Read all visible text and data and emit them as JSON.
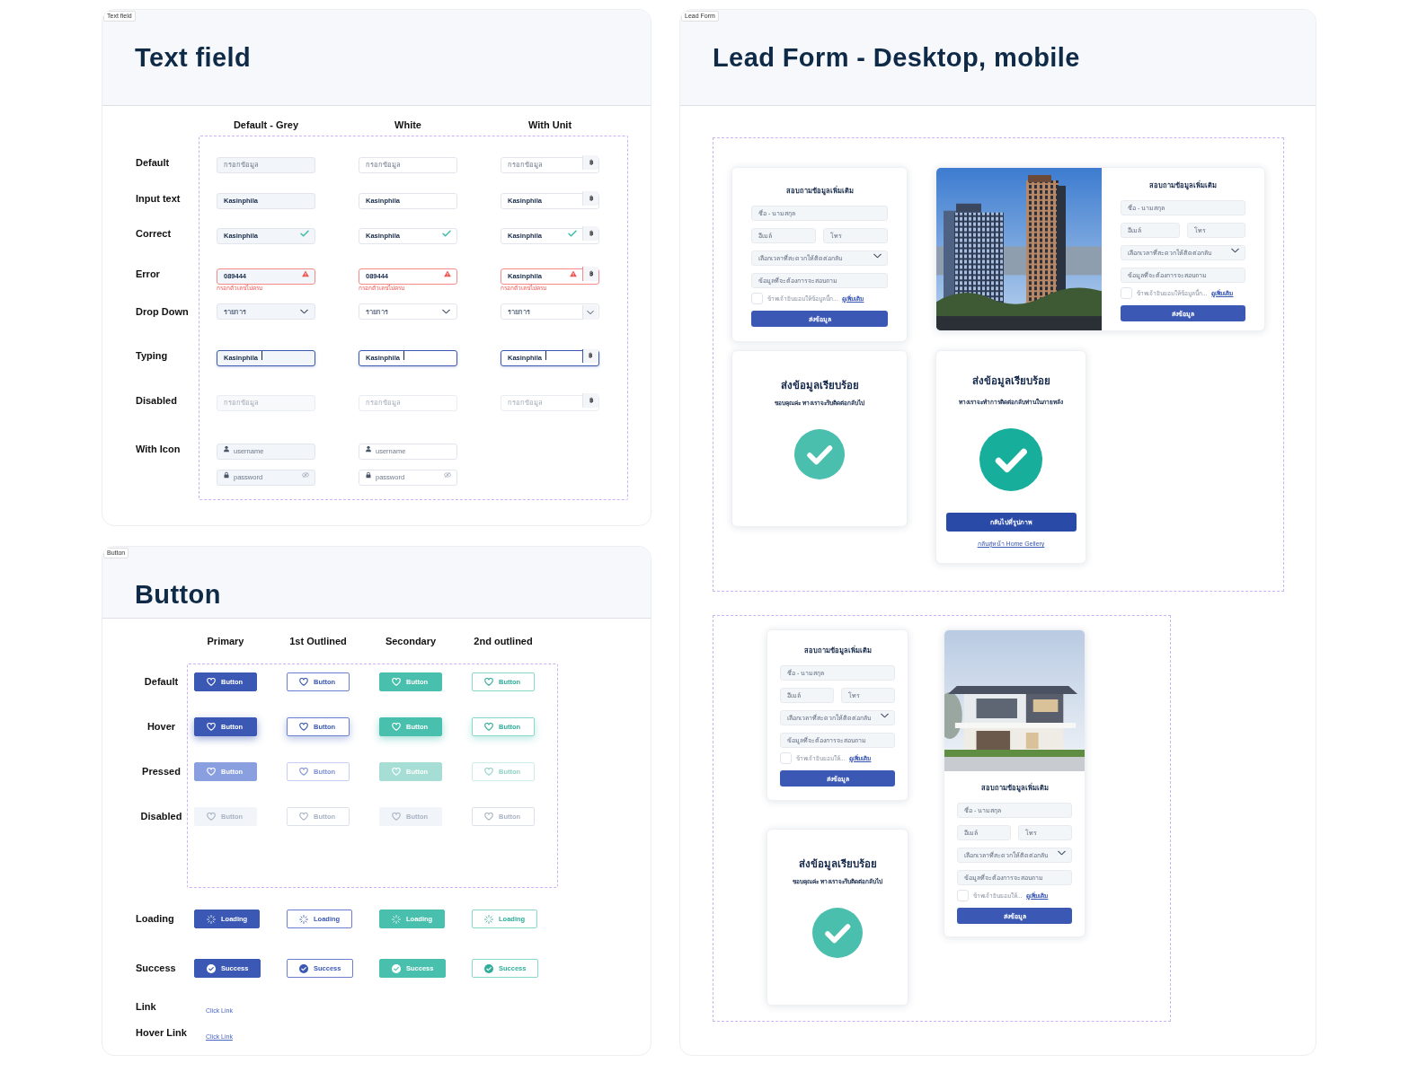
{
  "text_field": {
    "tag": "Text field",
    "title": "Text field",
    "columns": [
      {
        "label": "Default - Grey",
        "kind": "grey"
      },
      {
        "label": "White",
        "kind": "white"
      },
      {
        "label": "With Unit",
        "kind": "unit"
      }
    ],
    "rows": [
      {
        "label": "Default",
        "kind": "default",
        "cells": [
          {
            "placeholder": "กรอกข้อมูล"
          },
          {
            "placeholder": "กรอกข้อมูล"
          },
          {
            "placeholder": "กรอกข้อมูล",
            "unit": "฿"
          }
        ]
      },
      {
        "label": "Input text",
        "kind": "filled",
        "cells": [
          {
            "value": "Kasinphila"
          },
          {
            "value": "Kasinphila"
          },
          {
            "value": "Kasinphila",
            "unit": "฿"
          }
        ]
      },
      {
        "label": "Correct",
        "kind": "correct",
        "cells": [
          {
            "value": "Kasinphila"
          },
          {
            "value": "Kasinphila"
          },
          {
            "value": "Kasinphila",
            "unit": "฿"
          }
        ]
      },
      {
        "label": "Error",
        "kind": "error",
        "cells": [
          {
            "value": "089444",
            "error": "กรอกตัวเลขไม่ครบ"
          },
          {
            "value": "089444",
            "error": "กรอกตัวเลขไม่ครบ"
          },
          {
            "value": "Kasinphila",
            "error": "กรอกตัวเลขไม่ครบ",
            "unit": "฿"
          }
        ]
      },
      {
        "label": "Drop Down",
        "kind": "dropdown",
        "cells": [
          {
            "value": "รายการ"
          },
          {
            "value": "รายการ"
          },
          {
            "value": "รายการ"
          }
        ]
      },
      {
        "label": "Typing",
        "kind": "typing",
        "cells": [
          {
            "value": "Kasinphila"
          },
          {
            "value": "Kasinphila"
          },
          {
            "value": "Kasinphila",
            "unit": "฿"
          }
        ]
      },
      {
        "label": "Disabled",
        "kind": "disabled",
        "cells": [
          {
            "placeholder": "กรอกข้อมูล"
          },
          {
            "placeholder": "กรอกข้อมูล"
          },
          {
            "placeholder": "กรอกข้อมูล",
            "unit": "฿"
          }
        ]
      },
      {
        "label": "With Icon",
        "kind": "with_icon",
        "cells": [
          {
            "fields": [
              {
                "kind": "user",
                "placeholder": "username"
              },
              {
                "kind": "password",
                "placeholder": "password"
              }
            ]
          },
          {
            "fields": [
              {
                "kind": "user",
                "placeholder": "username"
              },
              {
                "kind": "password",
                "placeholder": "password"
              }
            ]
          }
        ]
      }
    ]
  },
  "buttons": {
    "tag": "Button",
    "title": "Button",
    "columns": [
      {
        "label": "Primary",
        "kind": "primary"
      },
      {
        "label": "1st Outlined",
        "kind": "outlined"
      },
      {
        "label": "Secondary",
        "kind": "secondary"
      },
      {
        "label": "2nd outlined",
        "kind": "outlined_secondary"
      }
    ],
    "state_rows": [
      {
        "label": "Default",
        "kind": "default",
        "buttons": [
          "Button",
          "Button",
          "Button",
          "Button"
        ]
      },
      {
        "label": "Hover",
        "kind": "hover",
        "buttons": [
          "Button",
          "Button",
          "Button",
          "Button"
        ]
      },
      {
        "label": "Pressed",
        "kind": "pressed",
        "buttons": [
          "Button",
          "Button",
          "Button",
          "Button"
        ]
      },
      {
        "label": "Disabled",
        "kind": "disabled",
        "buttons": [
          "Button",
          "Button",
          "Button",
          "Button"
        ]
      }
    ],
    "rows": [
      {
        "label": "Loading",
        "kind": "loading",
        "buttons": [
          "Loading",
          "Loading",
          "Loading",
          "Loading"
        ]
      },
      {
        "label": "Success",
        "kind": "success",
        "buttons": [
          "Success",
          "Success",
          "Success",
          "Success"
        ]
      },
      {
        "label": "Link",
        "kind": "link",
        "buttons": [
          "Click Link"
        ]
      },
      {
        "label": "Hover Link",
        "kind": "hover_link",
        "buttons": [
          "Click Link"
        ]
      }
    ]
  },
  "lead_form": {
    "tag": "Lead Form",
    "title": "Lead Form - Desktop, mobile",
    "sections": [
      {
        "kind": "desktop",
        "cards": [
          {
            "kind": "form",
            "title": "สอบถามข้อมูลเพิ่มเติม",
            "fields": [
              {
                "kind": "text",
                "placeholder": "ชื่อ - นามสกุล"
              },
              {
                "kind": "half",
                "placeholder": "อีเมล์"
              },
              {
                "kind": "half",
                "placeholder": "โทร"
              },
              {
                "kind": "select",
                "placeholder": "เลือกเวลาที่สะดวกให้ติดต่อกลับ"
              },
              {
                "kind": "text",
                "placeholder": "ข้อมูลที่จะต้องการจะสอบถาม"
              }
            ],
            "checked": false,
            "consent": "ข้าพเจ้ายินยอมให้ข้อมูลนี้ก...",
            "consent_link": "ดูเพิ่มเติม",
            "submit": "ส่งข้อมูล"
          },
          {
            "kind": "image_side",
            "title": "สอบถามข้อมูลเพิ่มเติม",
            "fields": [
              {
                "kind": "text",
                "placeholder": "ชื่อ - นามสกุล"
              },
              {
                "kind": "half",
                "placeholder": "อีเมล์"
              },
              {
                "kind": "half",
                "placeholder": "โทร"
              },
              {
                "kind": "select",
                "placeholder": "เลือกเวลาที่สะดวกให้ติดต่อกลับ"
              },
              {
                "kind": "text",
                "placeholder": "ข้อมูลที่จะต้องการจะสอบถาม"
              }
            ],
            "checked": false,
            "consent": "ข้าพเจ้ายินยอมให้ข้อมูลนี้ก...",
            "consent_link": "ดูเพิ่มเติม",
            "submit": "ส่งข้อมูล"
          },
          {
            "kind": "success",
            "title": "ส่งข้อมูลเรียบร้อย",
            "message": "ขอบคุณค่ะ ทางเราจะรีบติดต่อกลับไป"
          },
          {
            "kind": "success",
            "title": "ส่งข้อมูลเรียบร้อย",
            "message": "ทางเราจะทำการติดต่อกลับท่านในภายหลัง",
            "button": "กลับไปที่รูปภาพ",
            "link": "กลับสู่หน้า Home Gellery"
          }
        ]
      },
      {
        "kind": "mobile",
        "cards": [
          {
            "kind": "form",
            "title": "สอบถามข้อมูลเพิ่มเติม",
            "fields": [
              {
                "kind": "text",
                "placeholder": "ชื่อ - นามสกุล"
              },
              {
                "kind": "half",
                "placeholder": "อีเมล์"
              },
              {
                "kind": "half",
                "placeholder": "โทร"
              },
              {
                "kind": "select",
                "placeholder": "เลือกเวลาที่สะดวกให้ติดต่อกลับ"
              },
              {
                "kind": "text",
                "placeholder": "ข้อมูลที่จะต้องการจะสอบถาม"
              }
            ],
            "checked": false,
            "consent": "ข้าพเจ้ายินยอมให้...",
            "consent_link": "ดูเพิ่มเติม",
            "submit": "ส่งข้อมูล"
          },
          {
            "kind": "image_top",
            "title": "สอบถามข้อมูลเพิ่มเติม",
            "fields": [
              {
                "kind": "text",
                "placeholder": "ชื่อ - นามสกุล"
              },
              {
                "kind": "half",
                "placeholder": "อีเมล์"
              },
              {
                "kind": "half",
                "placeholder": "โทร"
              },
              {
                "kind": "select",
                "placeholder": "เลือกเวลาที่สะดวกให้ติดต่อกลับ"
              },
              {
                "kind": "text",
                "placeholder": "ข้อมูลที่จะต้องการจะสอบถาม"
              }
            ],
            "checked": false,
            "consent": "ข้าพเจ้ายินยอมให้...",
            "consent_link": "ดูเพิ่มเติม",
            "submit": "ส่งข้อมูล"
          },
          {
            "kind": "success",
            "title": "ส่งข้อมูลเรียบร้อย",
            "message": "ขอบคุณค่ะ ทางเราจะรีบติดต่อกลับไป"
          }
        ]
      }
    ]
  }
}
